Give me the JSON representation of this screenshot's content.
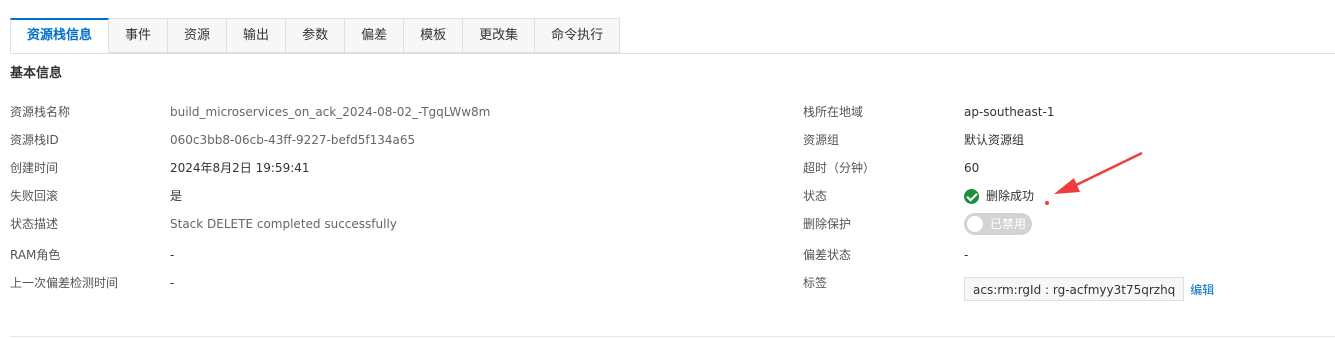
{
  "tabs": [
    {
      "label": "资源栈信息",
      "active": true
    },
    {
      "label": "事件"
    },
    {
      "label": "资源"
    },
    {
      "label": "输出"
    },
    {
      "label": "参数"
    },
    {
      "label": "偏差"
    },
    {
      "label": "模板"
    },
    {
      "label": "更改集"
    },
    {
      "label": "命令执行"
    }
  ],
  "section_title": "基本信息",
  "left_fields": [
    {
      "label": "资源栈名称",
      "value": "build_microservices_on_ack_2024-08-02_-TgqLWw8m"
    },
    {
      "label": "资源栈ID",
      "value": "060c3bb8-06cb-43ff-9227-befd5f134a65"
    },
    {
      "label": "创建时间",
      "value": "2024年8月2日 19:59:41"
    },
    {
      "label": "失败回滚",
      "value": "是"
    },
    {
      "label": "状态描述",
      "value": "Stack DELETE completed successfully"
    },
    {
      "label": "RAM角色",
      "value": "-"
    },
    {
      "label": "上一次偏差检测时间",
      "value": "-"
    }
  ],
  "right_fields": {
    "region": {
      "label": "栈所在地域",
      "value": "ap-southeast-1"
    },
    "resource_group": {
      "label": "资源组",
      "value": "默认资源组"
    },
    "timeout": {
      "label": "超时（分钟）",
      "value": "60"
    },
    "status": {
      "label": "状态",
      "value": "删除成功",
      "color": "#1e8e3e"
    },
    "deletion_protection": {
      "label": "删除保护",
      "value": "已禁用"
    },
    "drift_status": {
      "label": "偏差状态",
      "value": "-"
    },
    "tags": {
      "label": "标签",
      "value": "acs:rm:rgId : rg-acfmyy3t75qrzhq",
      "edit_label": "编辑"
    }
  },
  "colors": {
    "accent": "#0070cc",
    "annotation_arrow": "#f03c3c"
  }
}
